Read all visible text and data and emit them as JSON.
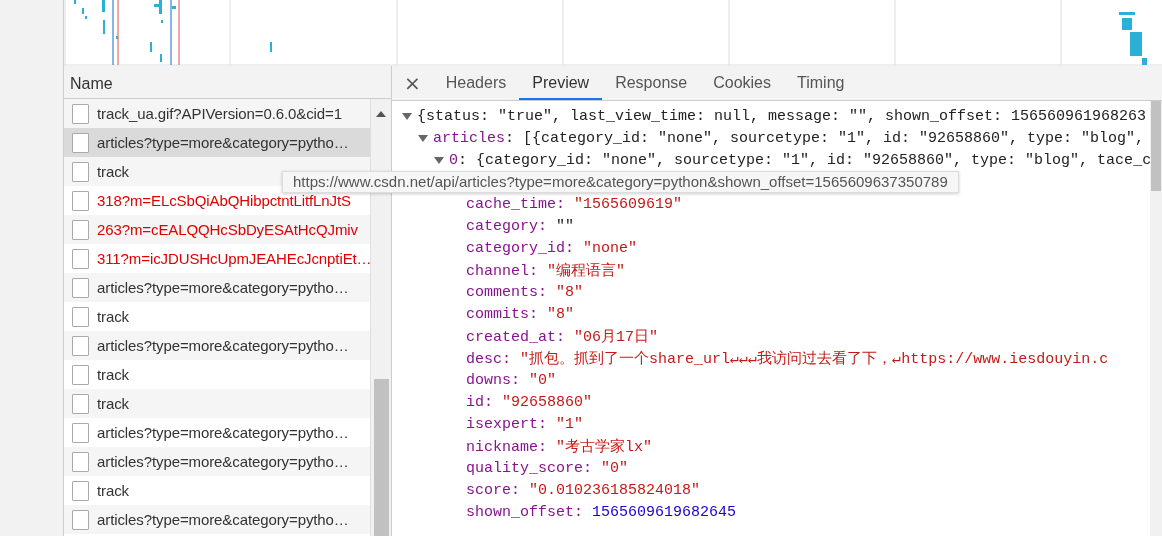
{
  "requests": {
    "header": "Name",
    "rows": [
      {
        "name": "track_ua.gif?APIVersion=0.6.0&cid=1",
        "selected": false,
        "failed": false
      },
      {
        "name": "articles?type=more&category=pytho…",
        "selected": true,
        "failed": false
      },
      {
        "name": "track",
        "selected": false,
        "failed": false
      },
      {
        "name": "318?m=ELcSbQiAbQHibpctntLitfLnJtS",
        "selected": false,
        "failed": true
      },
      {
        "name": "263?m=cEALQQHcSbDyESAtHcQJmiv",
        "selected": false,
        "failed": true
      },
      {
        "name": "311?m=icJDUSHcUpmJEAHEcJcnptiEt…",
        "selected": false,
        "failed": true
      },
      {
        "name": "articles?type=more&category=pytho…",
        "selected": false,
        "failed": false
      },
      {
        "name": "track",
        "selected": false,
        "failed": false
      },
      {
        "name": "articles?type=more&category=pytho…",
        "selected": false,
        "failed": false
      },
      {
        "name": "track",
        "selected": false,
        "failed": false
      },
      {
        "name": "track",
        "selected": false,
        "failed": false
      },
      {
        "name": "articles?type=more&category=pytho…",
        "selected": false,
        "failed": false
      },
      {
        "name": "articles?type=more&category=pytho…",
        "selected": false,
        "failed": false
      },
      {
        "name": "track",
        "selected": false,
        "failed": false
      },
      {
        "name": "articles?type=more&category=pytho…",
        "selected": false,
        "failed": false
      }
    ]
  },
  "detail": {
    "close": "×",
    "tabs": [
      {
        "label": "Headers",
        "selected": false
      },
      {
        "label": "Preview",
        "selected": true
      },
      {
        "label": "Response",
        "selected": false
      },
      {
        "label": "Cookies",
        "selected": false
      },
      {
        "label": "Timing",
        "selected": false
      }
    ],
    "preview": {
      "text": "{status: \"true\", last_view_time: null, message: \"\", shown_offset: 156560961968263",
      "expanded": true,
      "children": [
        {
          "key": "articles",
          "text": ": [{category_id: \"none\", sourcetype: \"1\", id: \"92658860\", type: \"blog\",",
          "expanded": true,
          "children": [
            {
              "key": "0",
              "text": ": {category_id: \"none\", sourcetype: \"1\", id: \"92658860\", type: \"blog\", tace_c",
              "expanded": true,
              "children": [
                {
                  "key": "cache_time:",
                  "value": "\"1565609619\"",
                  "kind": "string"
                },
                {
                  "key": "category:",
                  "value": "\"\"",
                  "kind": "plain"
                },
                {
                  "key": "category_id:",
                  "value": "\"none\"",
                  "kind": "string"
                },
                {
                  "key": "channel:",
                  "value": "\"编程语言\"",
                  "kind": "string"
                },
                {
                  "key": "comments:",
                  "value": "\"8\"",
                  "kind": "string"
                },
                {
                  "key": "commits:",
                  "value": "\"8\"",
                  "kind": "string"
                },
                {
                  "key": "created_at:",
                  "value": "\"06月17日\"",
                  "kind": "string"
                },
                {
                  "key": "desc:",
                  "value": "\"抓包。抓到了一个share_url↵↵↵我访问过去看了下，↵https://www.iesdouyin.c",
                  "kind": "string"
                },
                {
                  "key": "downs:",
                  "value": "\"0\"",
                  "kind": "string"
                },
                {
                  "key": "id:",
                  "value": "\"92658860\"",
                  "kind": "string"
                },
                {
                  "key": "isexpert:",
                  "value": "\"1\"",
                  "kind": "string"
                },
                {
                  "key": "nickname:",
                  "value": "\"考古学家lx\"",
                  "kind": "string"
                },
                {
                  "key": "quality_score:",
                  "value": "\"0\"",
                  "kind": "string"
                },
                {
                  "key": "score:",
                  "value": "\"0.010236185824018\"",
                  "kind": "string"
                },
                {
                  "key": "shown_offset:",
                  "value": "1565609619682645",
                  "kind": "number"
                }
              ]
            }
          ]
        }
      ]
    },
    "tooltip": "https://www.csdn.net/api/articles?type=more&category=python&shown_offset=1565609637350789"
  }
}
